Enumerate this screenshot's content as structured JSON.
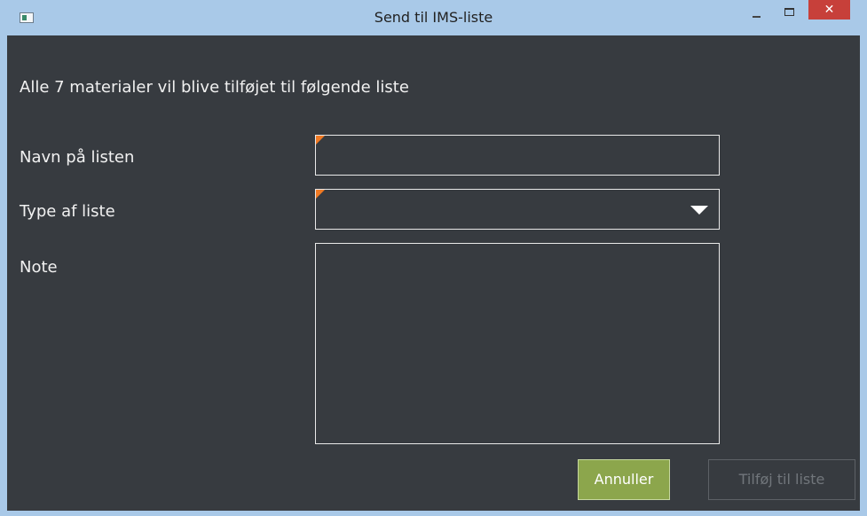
{
  "window": {
    "title": "Send til IMS-liste",
    "close_glyph": "✕"
  },
  "form": {
    "heading": "Alle 7 materialer vil blive tilføjet til følgende liste",
    "name_label": "Navn på listen",
    "name_value": "",
    "type_label": "Type af liste",
    "type_value": "",
    "note_label": "Note",
    "note_value": ""
  },
  "buttons": {
    "cancel_label": "Annuller",
    "add_label": "Tilføj til liste"
  },
  "colors": {
    "background": "#373b40",
    "accent_button": "#8ca64c",
    "required_marker": "#f07a24",
    "close_button": "#c7403a"
  }
}
